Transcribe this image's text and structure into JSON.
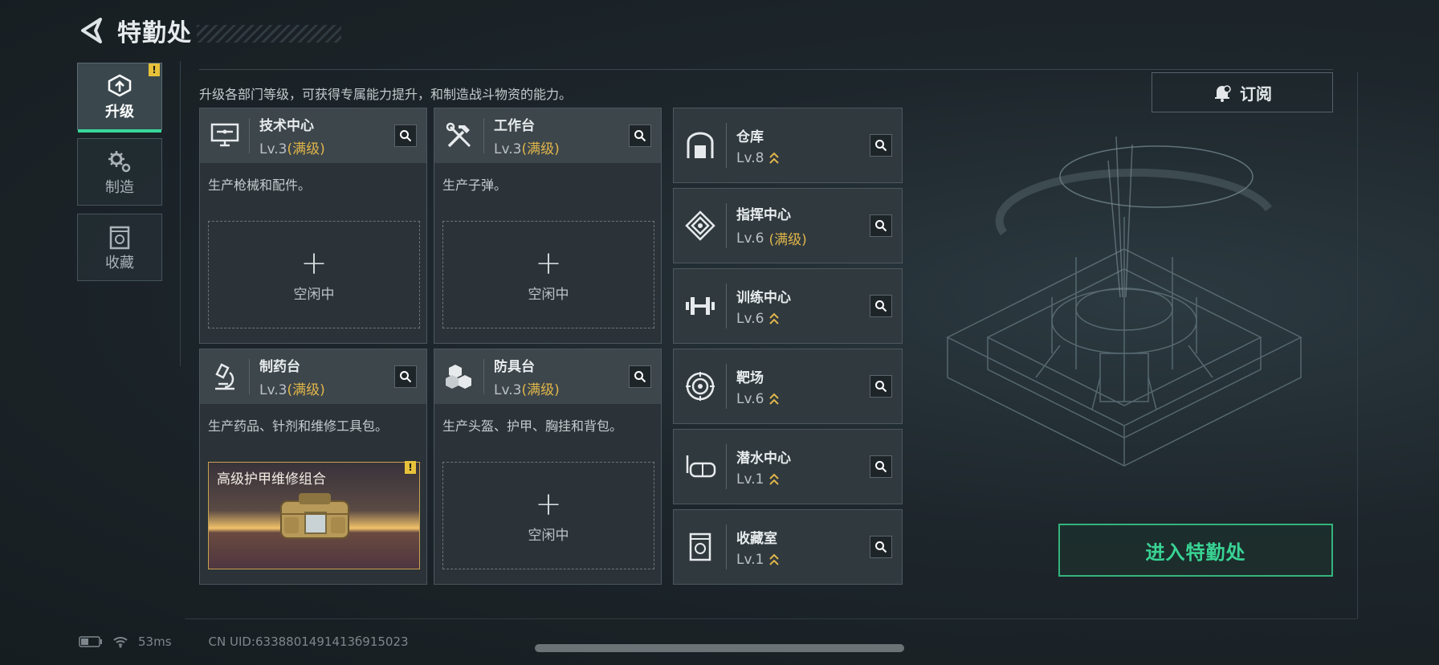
{
  "header": {
    "title": "特勤处"
  },
  "tabs": [
    {
      "label": "升级",
      "icon": "upgrade-icon",
      "active": true,
      "warning": "!"
    },
    {
      "label": "制造",
      "icon": "gear-icon",
      "active": false
    },
    {
      "label": "收藏",
      "icon": "collection-icon",
      "active": false
    }
  ],
  "intro": "升级各部门等级，可获得专属能力提升，和制造战斗物资的能力。",
  "subscribe_label": "订阅",
  "cards": [
    {
      "name": "技术中心",
      "level": "Lv.3",
      "max": "(满级)",
      "desc": "生产枪械和配件。",
      "slot_plus": "+",
      "slot_label": "空闲中"
    },
    {
      "name": "工作台",
      "level": "Lv.3",
      "max": "(满级)",
      "desc": "生产子弹。",
      "slot_plus": "+",
      "slot_label": "空闲中"
    },
    {
      "name": "制药台",
      "level": "Lv.3",
      "max": "(满级)",
      "desc": "生产药品、针剂和维修工具包。",
      "craft_label": "高级护甲维修组合",
      "craft_warning": "!"
    },
    {
      "name": "防具台",
      "level": "Lv.3",
      "max": "(满级)",
      "desc": "生产头盔、护甲、胸挂和背包。",
      "slot_plus": "+",
      "slot_label": "空闲中"
    }
  ],
  "facilities": [
    {
      "name": "仓库",
      "level": "Lv.8",
      "max": "",
      "upgradable": true
    },
    {
      "name": "指挥中心",
      "level": "Lv.6",
      "max": "(满级)",
      "upgradable": false
    },
    {
      "name": "训练中心",
      "level": "Lv.6",
      "max": "",
      "upgradable": true
    },
    {
      "name": "靶场",
      "level": "Lv.6",
      "max": "",
      "upgradable": true
    },
    {
      "name": "潜水中心",
      "level": "Lv.1",
      "max": "",
      "upgradable": true
    },
    {
      "name": "收藏室",
      "level": "Lv.1",
      "max": "",
      "upgradable": true
    }
  ],
  "enter_button": "进入特勤处",
  "status": {
    "ping": "53ms",
    "uid": "CN UID:6338801491413б915023"
  },
  "colors": {
    "accent_green": "#39d494",
    "gold": "#e1b64a",
    "warning": "#e7c13a"
  }
}
